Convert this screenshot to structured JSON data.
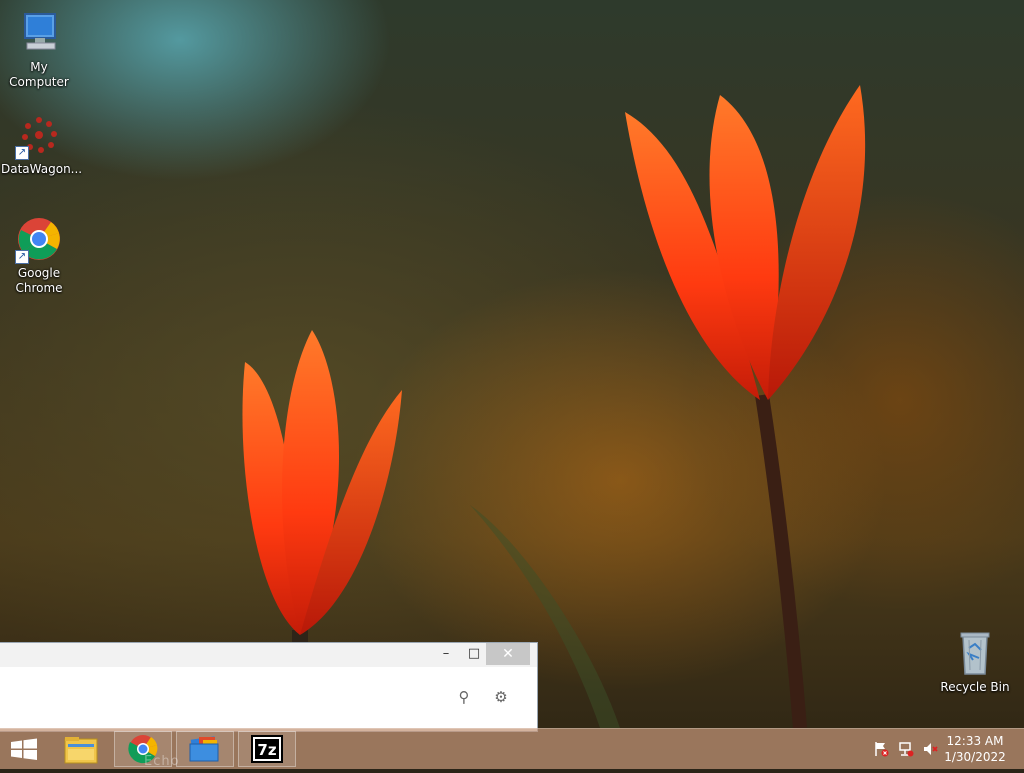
{
  "desktop": {
    "icons": [
      {
        "label": "My Computer",
        "icon": "computer-icon"
      },
      {
        "label": "DataWagon...",
        "icon": "datawagon-icon"
      },
      {
        "label_line1": "Google",
        "label_line2": "Chrome",
        "icon": "chrome-icon"
      },
      {
        "label": "Recycle Bin",
        "icon": "recycle-bin-icon"
      }
    ]
  },
  "window": {
    "minimize_glyph": "–",
    "maximize_glyph": "□",
    "close_glyph": "✕",
    "search_glyph": "⚲",
    "settings_glyph": "⚙"
  },
  "taskbar": {
    "ghost_text": "Echo",
    "pinned": [
      "windows-start-icon",
      "file-explorer-icon",
      "chrome-icon",
      "folder-windows-icon",
      "7zip-icon"
    ],
    "seven_zip_label": "7z",
    "clock_time": "12:33 AM",
    "clock_date": "1/30/2022"
  },
  "colors": {
    "accent_tulip": "#ff4a12",
    "taskbar": "#c49678"
  }
}
